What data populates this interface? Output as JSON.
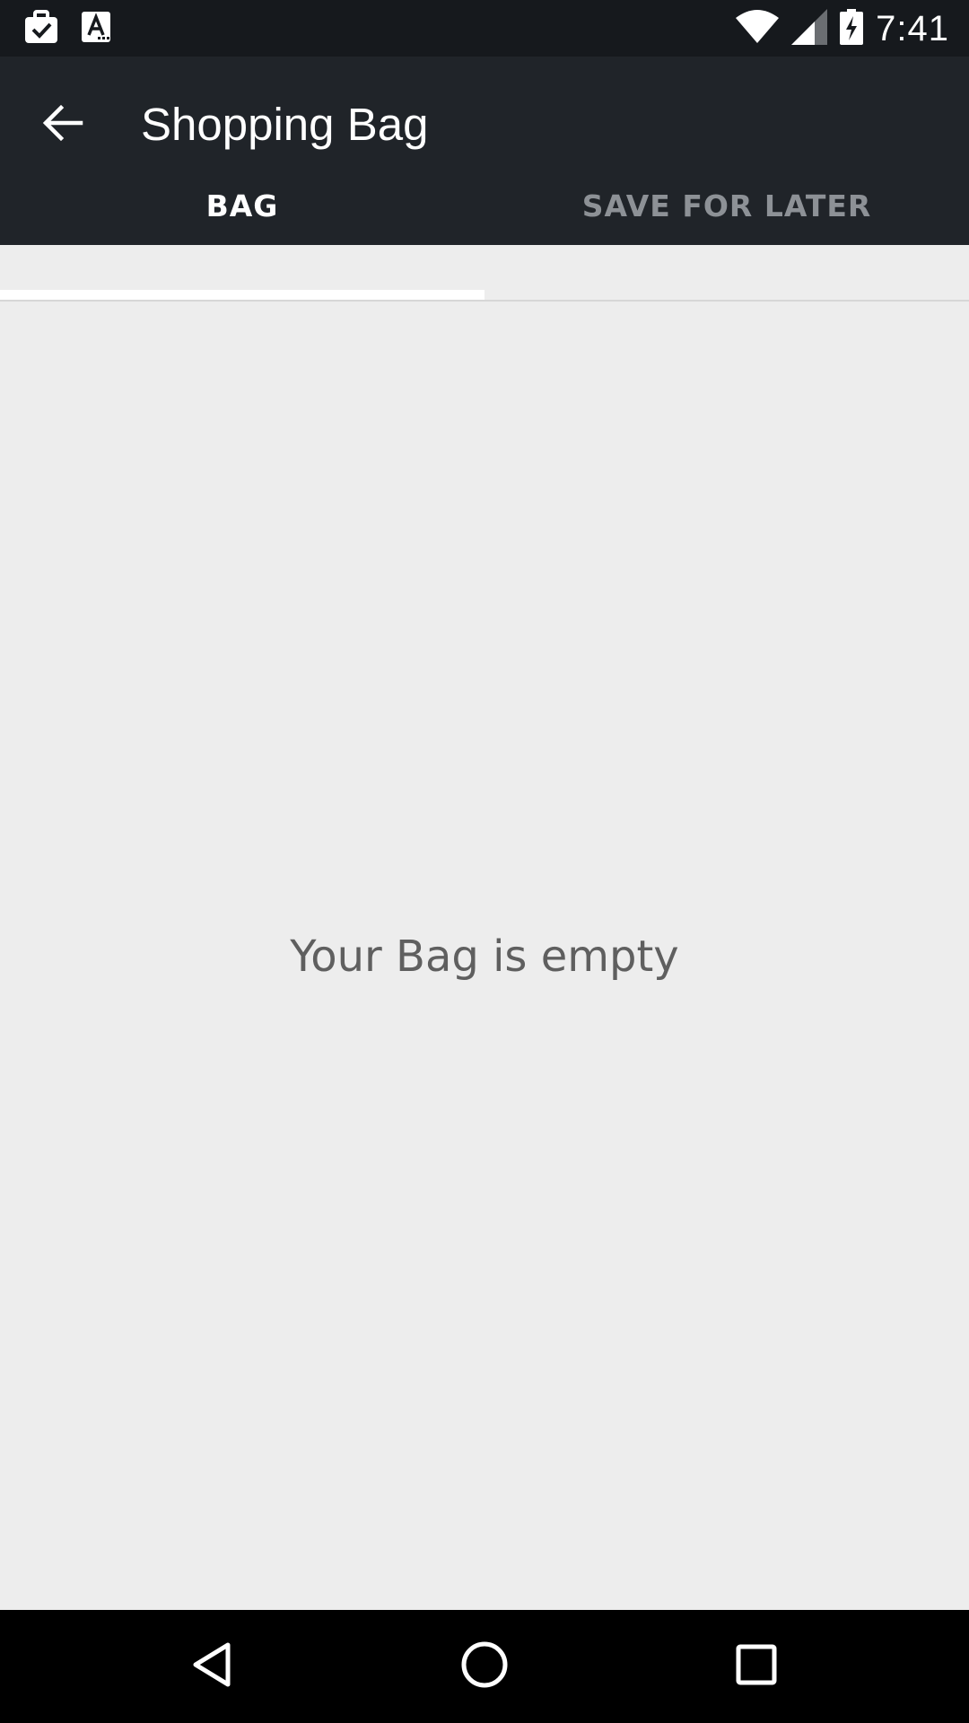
{
  "status_bar": {
    "time": "7:41",
    "left_icons": [
      "briefcase-check-icon",
      "text-a-icon"
    ],
    "right_icons": [
      "wifi-icon",
      "cell-signal-icon",
      "battery-charging-icon"
    ]
  },
  "app_bar": {
    "title": "Shopping Bag",
    "back_icon": "arrow-back-icon",
    "background": "#202429"
  },
  "tabs": [
    {
      "label": "BAG",
      "active": true
    },
    {
      "label": "SAVE FOR LATER",
      "active": false
    }
  ],
  "main": {
    "empty_message": "Your Bag is empty"
  },
  "nav_bar": {
    "buttons": [
      "back-triangle-icon",
      "home-circle-icon",
      "recents-square-icon"
    ]
  },
  "colors": {
    "status_bar": "#16191d",
    "app_bar": "#202429",
    "content_background": "#ededed",
    "tab_active": "#ffffff",
    "tab_inactive": "#8d9196",
    "empty_text": "#5f5f5f"
  }
}
